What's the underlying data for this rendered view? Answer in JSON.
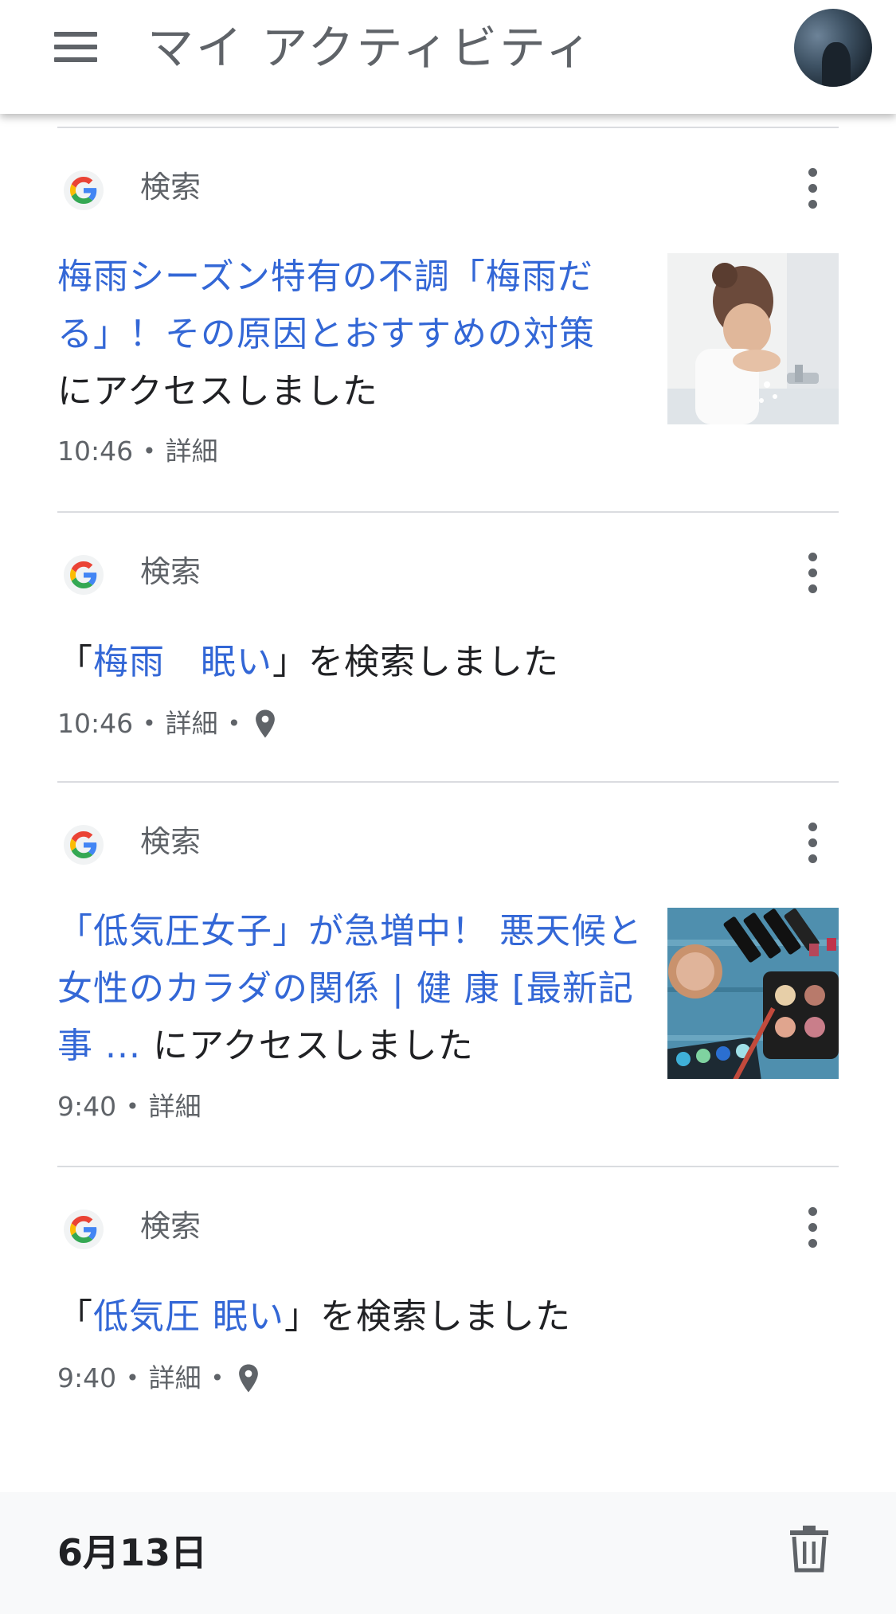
{
  "app_bar": {
    "title": "マイ アクティビティ",
    "menu_icon": "hamburger-menu-icon",
    "avatar_icon": "account-avatar"
  },
  "activities": [
    {
      "source": "検索",
      "link_text": "梅雨シーズン特有の不調「梅雨だる」！その原因とおすすめの対策",
      "suffix": "にアクセスしました",
      "time": "10:46",
      "details_label": "詳細",
      "thumbnail": "woman-washing-face"
    },
    {
      "source": "検索",
      "prefix": "「",
      "link_text": "梅雨　眠い",
      "suffix": "」を検索しました",
      "time": "10:46",
      "details_label": "詳細",
      "location_icon": "location-pin-icon"
    },
    {
      "source": "検索",
      "link_text": "「低気圧女子」が急増中！ 悪天候と女性のカラダの関係 | 健 康 [最新記事 ...",
      "suffix": " にアクセスしました",
      "time": "9:40",
      "details_label": "詳細",
      "thumbnail": "makeup-products"
    },
    {
      "source": "検索",
      "prefix": "「",
      "link_text": "低気圧 眠い",
      "suffix": "」を検索しました",
      "time": "9:40",
      "details_label": "詳細",
      "location_icon": "location-pin-icon"
    }
  ],
  "date_header": {
    "label": "6月13日",
    "delete_icon": "trash-icon"
  },
  "colors": {
    "link": "#3367d6",
    "secondary_text": "#5f6368",
    "divider": "#dadce0"
  }
}
